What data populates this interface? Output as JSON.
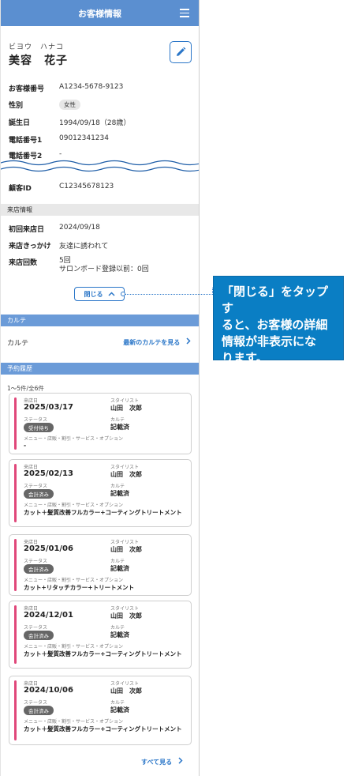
{
  "header": {
    "title": "お客様情報"
  },
  "customer": {
    "kana": "ビヨウ　ハナコ",
    "name": "美容　花子"
  },
  "info": [
    {
      "label": "お客様番号",
      "value": "A1234-5678-9123"
    },
    {
      "label": "性別",
      "value": "女性"
    },
    {
      "label": "誕生日",
      "value": "1994/09/18（28歳）"
    },
    {
      "label": "電話番号1",
      "value": "09012341234"
    },
    {
      "label": "電話番号2",
      "value": "-"
    },
    {
      "label": "顧客ID",
      "value": "C12345678123"
    }
  ],
  "visit_section": {
    "title": "来店情報",
    "rows": [
      {
        "label": "初回来店日",
        "value": "2024/09/18"
      },
      {
        "label": "来店きっかけ",
        "value": "友達に誘われて"
      },
      {
        "label": "来店回数",
        "value": "5回",
        "value2": "サロンボード登録以前：0回"
      }
    ]
  },
  "close_button": {
    "label": "閉じる"
  },
  "karte_section": {
    "title": "カルテ",
    "label": "カルテ",
    "link": "最新のカルテを見る"
  },
  "reservation_section": {
    "title": "予約履歴",
    "count": "1〜5件/全6件",
    "field_labels": {
      "date": "来店日",
      "stylist": "スタイリスト",
      "status": "ステータス",
      "karte": "カルテ",
      "menu": "メニュー・店販・割引・サービス・オプション"
    },
    "cards": [
      {
        "date": "2025/03/17",
        "stylist": "山田　次郎",
        "status": "受付待ち",
        "karte": "記載済",
        "menu": "-"
      },
      {
        "date": "2025/02/13",
        "stylist": "山田　次郎",
        "status": "会計済み",
        "karte": "記載済",
        "menu": "カット＋髪質改善フルカラー+コーティングトリートメント"
      },
      {
        "date": "2025/01/06",
        "stylist": "山田　次郎",
        "status": "会計済み",
        "karte": "記載済",
        "menu": "カット+リタッチカラー+トリートメント"
      },
      {
        "date": "2024/12/01",
        "stylist": "山田　次郎",
        "status": "会計済み",
        "karte": "記載済",
        "menu": "カット＋髪質改善フルカラー+コーティングトリートメント"
      },
      {
        "date": "2024/10/06",
        "stylist": "山田　次郎",
        "status": "会計済み",
        "karte": "記載済",
        "menu": "カット＋髪質改善フルカラー+コーティングトリートメント"
      }
    ],
    "all_link": "すべて見る"
  },
  "callout": {
    "lines": [
      "「閉じる」をタップす",
      "ると、お客様の詳細",
      "情報が非表示にな",
      "ります。"
    ]
  },
  "colors": {
    "header_blue": "#5b8fd0",
    "section_blue": "#6b9bd8",
    "link_blue": "#2a76c8",
    "accent_pink": "#e0477a",
    "callout_blue": "#0a7ec4"
  }
}
